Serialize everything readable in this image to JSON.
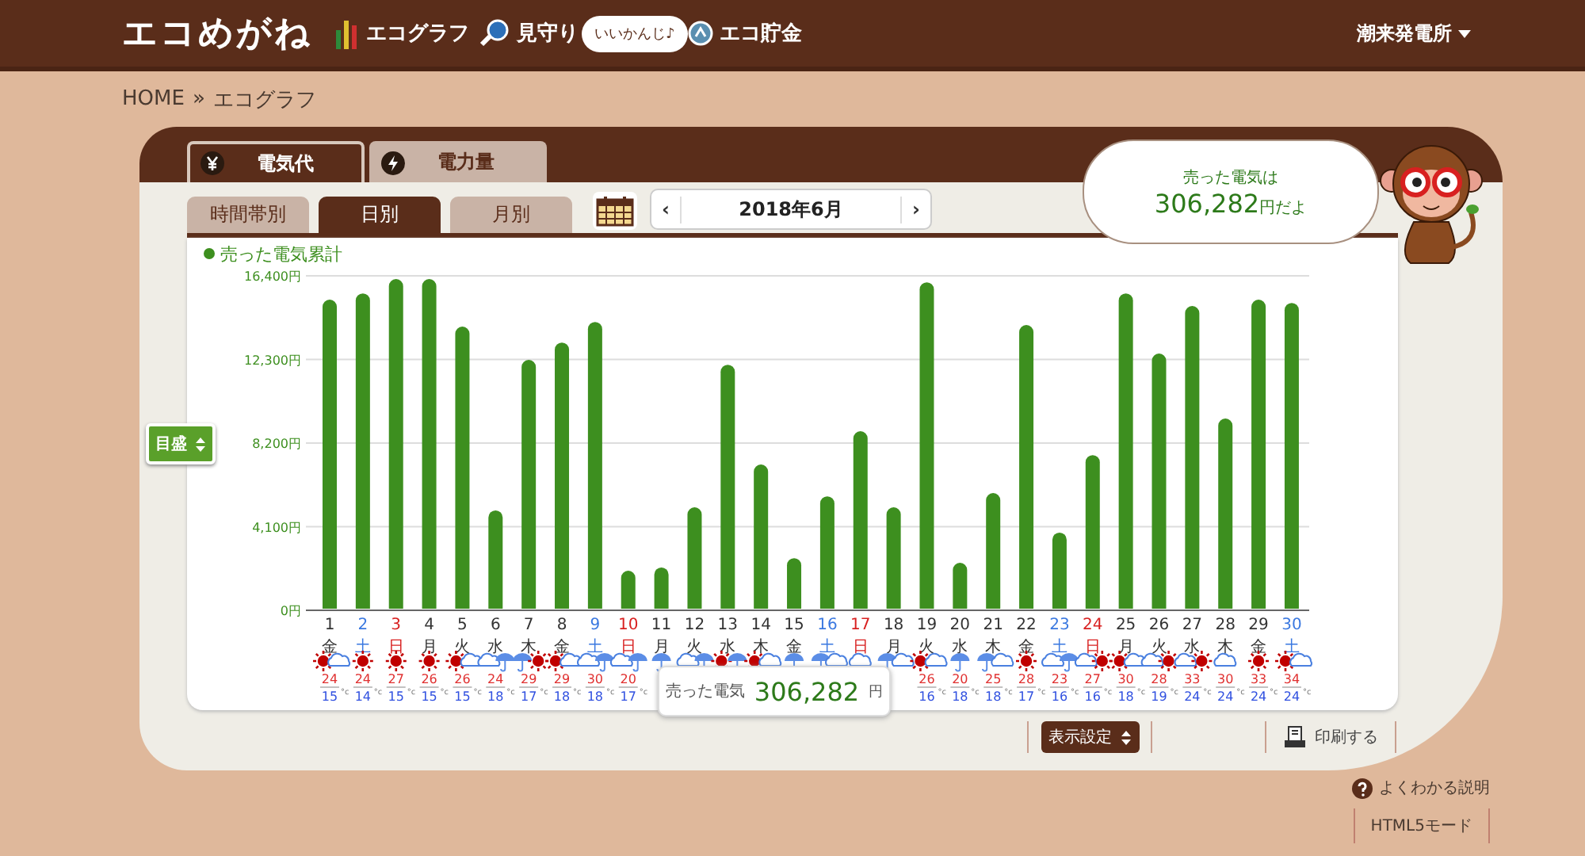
{
  "header": {
    "logo": "エコめがね",
    "nav": [
      {
        "label": "エコグラフ"
      },
      {
        "label": "見守り",
        "badge": "いいかんじ♪"
      },
      {
        "label": "エコ貯金"
      }
    ],
    "account": "潮来発電所"
  },
  "breadcrumb": {
    "items": [
      "HOME",
      "エコグラフ"
    ],
    "separator": "»"
  },
  "main_tabs": [
    {
      "label": "電気代",
      "selected": true
    },
    {
      "label": "電力量",
      "selected": false
    }
  ],
  "view_tabs": [
    {
      "label": "時間帯別",
      "selected": false
    },
    {
      "label": "日別",
      "selected": true
    },
    {
      "label": "月別",
      "selected": false
    }
  ],
  "date_nav": {
    "prev": "‹",
    "label": "2018年6月",
    "next": "›"
  },
  "speech_bubble": {
    "line1": "売った電気は",
    "amount": "306,282",
    "suffix": "円だよ"
  },
  "scale_button": {
    "label": "目盛"
  },
  "chart": {
    "chart_data": {
      "type": "bar",
      "grid": true,
      "categories": [
        "1",
        "2",
        "3",
        "4",
        "5",
        "6",
        "7",
        "8",
        "9",
        "10",
        "11",
        "12",
        "13",
        "14",
        "15",
        "16",
        "17",
        "18",
        "19",
        "20",
        "21",
        "22",
        "23",
        "24",
        "25",
        "26",
        "27",
        "28",
        "29",
        "30"
      ],
      "series": [
        {
          "name": "売った電気累計",
          "color": "#3d8f1f",
          "values": [
            15230,
            15540,
            16240,
            16240,
            13910,
            4900,
            12280,
            13130,
            14140,
            1940,
            2100,
            5050,
            12040,
            7150,
            2560,
            5590,
            8780,
            5050,
            16080,
            2330,
            5750,
            13990,
            3810,
            7610,
            15540,
            12590,
            14920,
            9400,
            15230,
            15070
          ]
        }
      ],
      "ylim": [
        0,
        16400
      ],
      "yticks": [
        {
          "value": 0,
          "label": "0円"
        },
        {
          "value": 4100,
          "label": "4,100円"
        },
        {
          "value": 8200,
          "label": "8,200円"
        },
        {
          "value": 12300,
          "label": "12,300円"
        },
        {
          "value": 16400,
          "label": "16,400円"
        }
      ]
    }
  },
  "days": [
    {
      "weekday": "金",
      "kind": "weekday",
      "weather": [
        {
          "kind": "sun"
        },
        {
          "kind": "cloud"
        }
      ],
      "high": "24",
      "low": "15",
      "unit": "°c"
    },
    {
      "weekday": "土",
      "kind": "saturday",
      "weather": [
        {
          "kind": "sun"
        }
      ],
      "high": "24",
      "low": "14",
      "unit": "°c"
    },
    {
      "weekday": "日",
      "kind": "sunday",
      "weather": [
        {
          "kind": "sun"
        }
      ],
      "high": "27",
      "low": "15",
      "unit": "°c"
    },
    {
      "weekday": "月",
      "kind": "weekday",
      "weather": [
        {
          "kind": "sun"
        }
      ],
      "high": "26",
      "low": "15",
      "unit": "°c"
    },
    {
      "weekday": "火",
      "kind": "weekday",
      "weather": [
        {
          "kind": "sun"
        },
        {
          "kind": "cloud"
        }
      ],
      "high": "26",
      "low": "15",
      "unit": "°c"
    },
    {
      "weekday": "水",
      "kind": "weekday",
      "weather": [
        {
          "kind": "cloud"
        },
        {
          "kind": "umbrella"
        }
      ],
      "high": "24",
      "low": "18",
      "unit": "°c"
    },
    {
      "weekday": "木",
      "kind": "weekday",
      "weather": [
        {
          "kind": "umbrella"
        },
        {
          "kind": "sun"
        }
      ],
      "high": "29",
      "low": "17",
      "unit": "°c"
    },
    {
      "weekday": "金",
      "kind": "weekday",
      "weather": [
        {
          "kind": "sun"
        },
        {
          "kind": "cloud"
        }
      ],
      "high": "29",
      "low": "18",
      "unit": "°c"
    },
    {
      "weekday": "土",
      "kind": "saturday",
      "weather": [
        {
          "kind": "cloud"
        },
        {
          "kind": "umbrella"
        }
      ],
      "high": "30",
      "low": "18",
      "unit": "°c"
    },
    {
      "weekday": "日",
      "kind": "sunday",
      "weather": [
        {
          "kind": "cloud"
        },
        {
          "kind": "umbrella"
        }
      ],
      "high": "20",
      "low": "17",
      "unit": "°c"
    },
    {
      "weekday": "月",
      "kind": "weekday",
      "weather": [
        {
          "kind": "umbrella"
        }
      ]
    },
    {
      "weekday": "火",
      "kind": "weekday",
      "weather": [
        {
          "kind": "cloud"
        },
        {
          "kind": "umbrella"
        }
      ]
    },
    {
      "weekday": "水",
      "kind": "weekday",
      "weather": [
        {
          "kind": "sun"
        },
        {
          "kind": "umbrella"
        }
      ]
    },
    {
      "weekday": "木",
      "kind": "weekday",
      "weather": [
        {
          "kind": "sun"
        },
        {
          "kind": "cloud"
        }
      ]
    },
    {
      "weekday": "金",
      "kind": "weekday",
      "weather": [
        {
          "kind": "umbrella"
        }
      ]
    },
    {
      "weekday": "土",
      "kind": "saturday",
      "weather": [
        {
          "kind": "umbrella"
        },
        {
          "kind": "cloud"
        }
      ]
    },
    {
      "weekday": "日",
      "kind": "sunday",
      "weather": [
        {
          "kind": "cloud"
        }
      ]
    },
    {
      "weekday": "月",
      "kind": "weekday",
      "weather": [
        {
          "kind": "umbrella"
        },
        {
          "kind": "cloud"
        }
      ]
    },
    {
      "weekday": "火",
      "kind": "weekday",
      "weather": [
        {
          "kind": "sun"
        },
        {
          "kind": "cloud"
        }
      ],
      "high": "26",
      "low": "16",
      "unit": "°c"
    },
    {
      "weekday": "水",
      "kind": "weekday",
      "weather": [
        {
          "kind": "umbrella"
        }
      ],
      "high": "20",
      "low": "18",
      "unit": "°c"
    },
    {
      "weekday": "木",
      "kind": "weekday",
      "weather": [
        {
          "kind": "umbrella"
        },
        {
          "kind": "cloud"
        }
      ],
      "high": "25",
      "low": "18",
      "unit": "°c"
    },
    {
      "weekday": "金",
      "kind": "weekday",
      "weather": [
        {
          "kind": "sun"
        }
      ],
      "high": "28",
      "low": "17",
      "unit": "°c"
    },
    {
      "weekday": "土",
      "kind": "saturday",
      "weather": [
        {
          "kind": "cloud"
        },
        {
          "kind": "umbrella"
        }
      ],
      "high": "23",
      "low": "16",
      "unit": "°c"
    },
    {
      "weekday": "日",
      "kind": "sunday",
      "weather": [
        {
          "kind": "cloud"
        },
        {
          "kind": "sun"
        }
      ],
      "high": "27",
      "low": "16",
      "unit": "°c"
    },
    {
      "weekday": "月",
      "kind": "weekday",
      "weather": [
        {
          "kind": "sun"
        },
        {
          "kind": "cloud"
        }
      ],
      "high": "30",
      "low": "18",
      "unit": "°c"
    },
    {
      "weekday": "火",
      "kind": "weekday",
      "weather": [
        {
          "kind": "cloud"
        },
        {
          "kind": "sun"
        }
      ],
      "high": "28",
      "low": "19",
      "unit": "°c"
    },
    {
      "weekday": "水",
      "kind": "weekday",
      "weather": [
        {
          "kind": "cloud"
        },
        {
          "kind": "sun"
        }
      ],
      "high": "33",
      "low": "24",
      "unit": "°c"
    },
    {
      "weekday": "木",
      "kind": "weekday",
      "weather": [
        {
          "kind": "cloud"
        }
      ],
      "high": "30",
      "low": "24",
      "unit": "°c"
    },
    {
      "weekday": "金",
      "kind": "weekday",
      "weather": [
        {
          "kind": "sun"
        }
      ],
      "high": "33",
      "low": "24",
      "unit": "°c"
    },
    {
      "weekday": "土",
      "kind": "saturday",
      "weather": [
        {
          "kind": "sun"
        },
        {
          "kind": "cloud"
        }
      ],
      "high": "34",
      "low": "24",
      "unit": "°c"
    }
  ],
  "tooltip": {
    "label": "売った電気",
    "amount": "306,282",
    "unit": "円"
  },
  "toolbar": {
    "display_settings": "表示設定",
    "print": "印刷する"
  },
  "help_link": "よくわかる説明",
  "html5_mode": "HTML5モード"
}
